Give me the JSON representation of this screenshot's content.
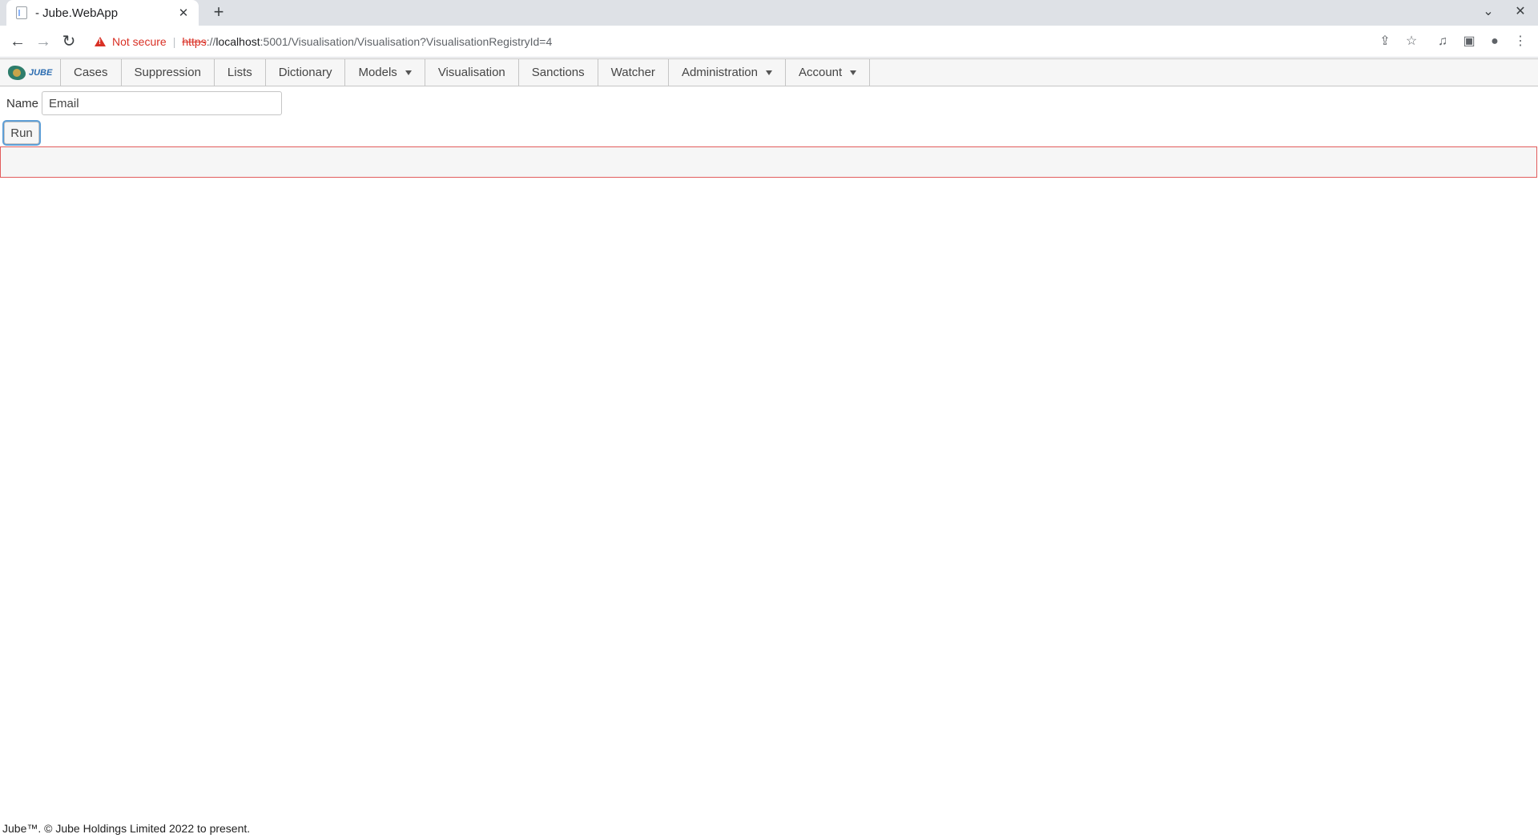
{
  "browser": {
    "tab_title": "- Jube.WebApp",
    "security_label": "Not secure",
    "url_scheme": "https",
    "url_host_sep": "://",
    "url_host": "localhost",
    "url_rest": ":5001/Visualisation/Visualisation?VisualisationRegistryId=4",
    "icons": [
      "back-arrow-icon",
      "forward-arrow-icon",
      "reload-icon",
      "warning-icon",
      "share-icon",
      "star-icon",
      "media-icon",
      "sidepanel-icon",
      "profile-icon",
      "kebab-menu-icon"
    ]
  },
  "nav": {
    "brand": "JUBE",
    "items": [
      "Cases",
      "Suppression",
      "Lists",
      "Dictionary",
      "Models",
      "Visualisation",
      "Sanctions",
      "Watcher",
      "Administration",
      "Account"
    ]
  },
  "form": {
    "name_label": "Name",
    "name_value": "Email",
    "run_label": "Run"
  },
  "colors": {
    "panel_border": "#e25c5c",
    "focus_ring": "#5e9ed6",
    "warning": "#d93025"
  },
  "footer": {
    "text": "Jube™. © Jube Holdings Limited 2022 to present."
  }
}
